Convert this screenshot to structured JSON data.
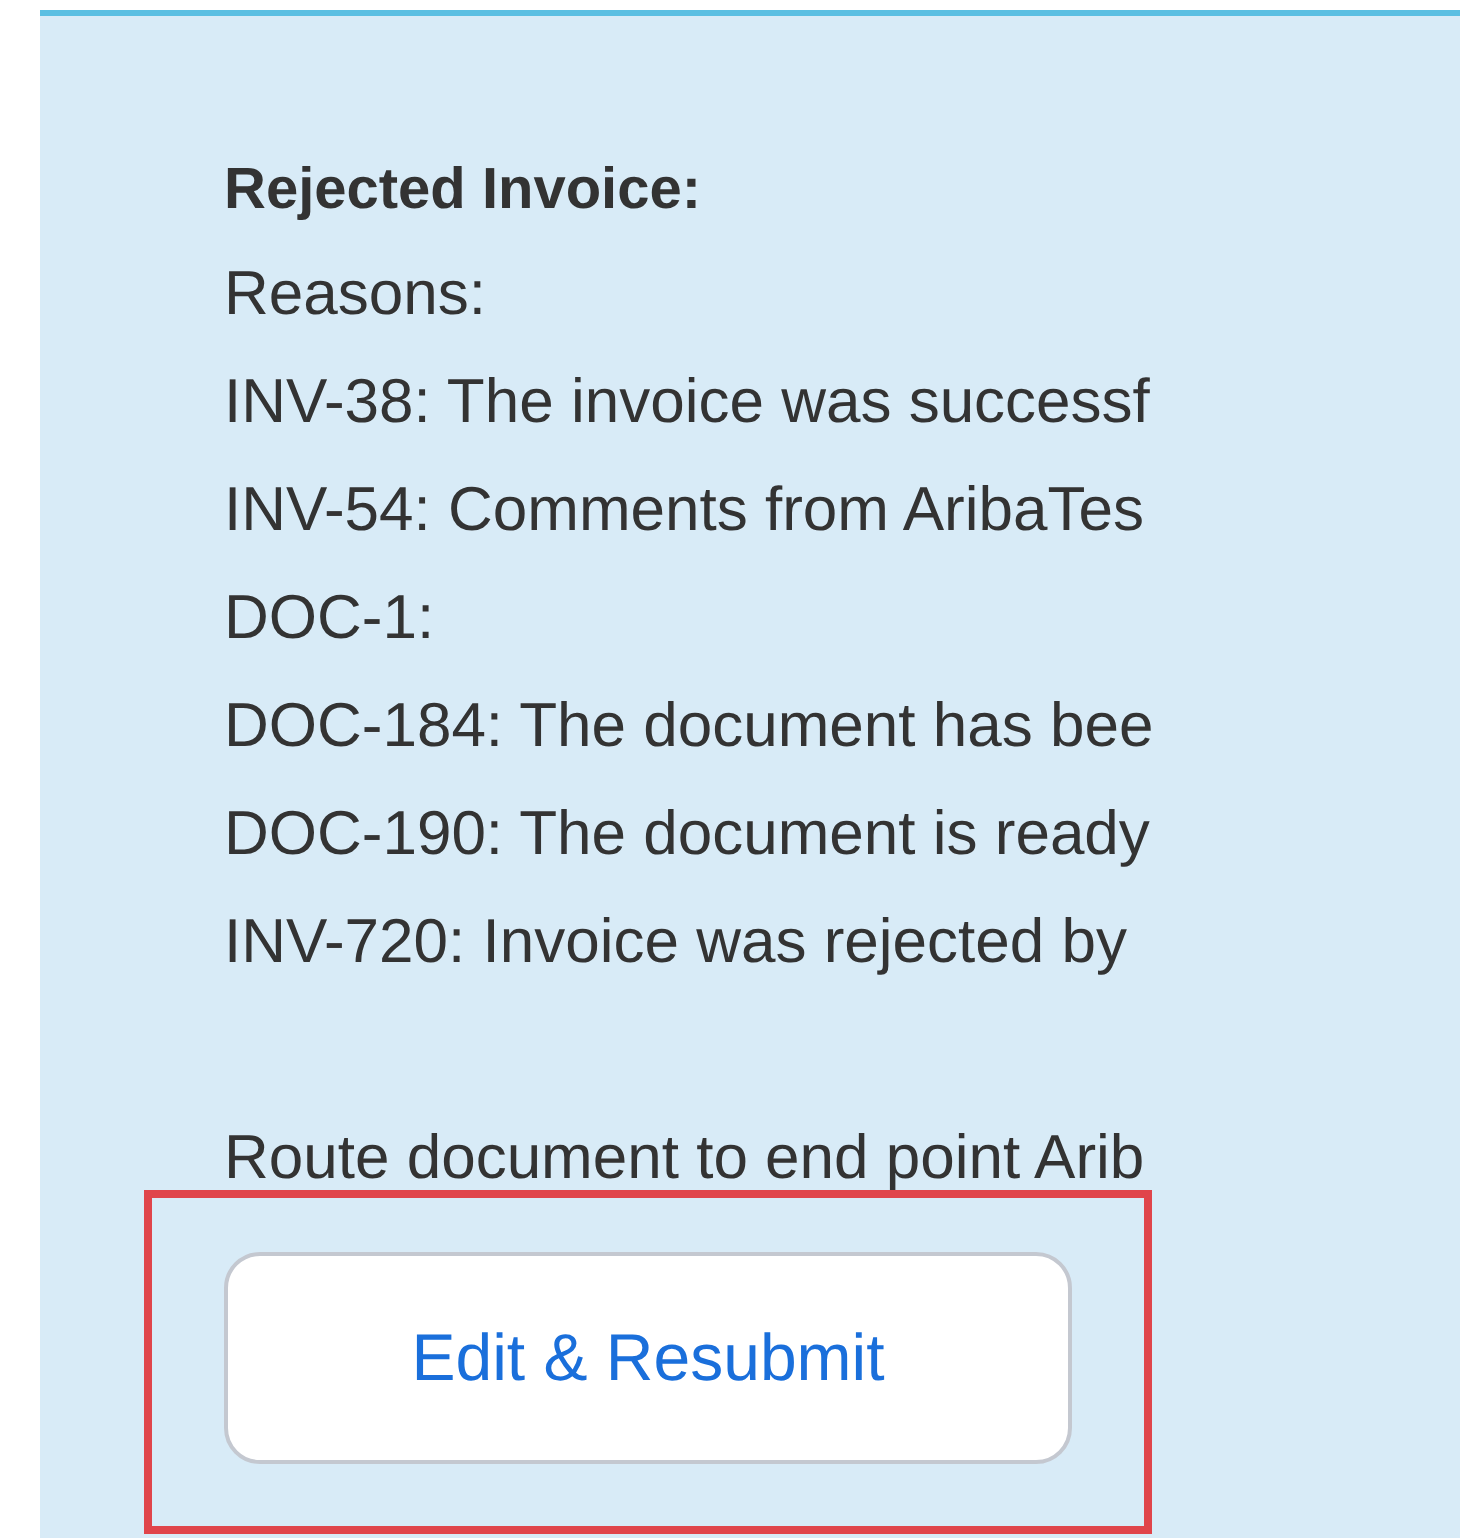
{
  "panel": {
    "heading": "Rejected Invoice:",
    "lines": [
      "Reasons:",
      "INV-38: The invoice was successf",
      "INV-54: Comments from AribaTes",
      "DOC-1:",
      "DOC-184: The document has bee",
      "DOC-190: The document is ready",
      "INV-720: Invoice was rejected by"
    ],
    "note": "Route document to end point Arib",
    "button": "Edit & Resubmit"
  }
}
